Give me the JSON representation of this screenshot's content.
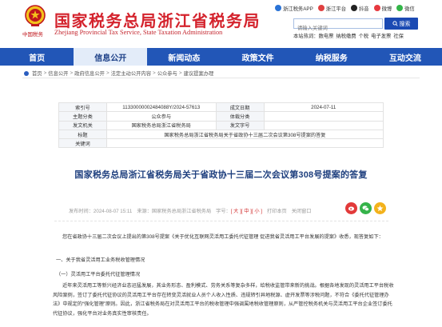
{
  "header": {
    "title": "国家税务总局浙江省税务局",
    "subtitle": "Zhejiang Provincial Tax Service, State Taxation Administration",
    "emblem_text": "中国税务"
  },
  "apps": [
    {
      "label": "浙江税务APP",
      "color": "#2a73d6"
    },
    {
      "label": "浙江平台",
      "color": "#e04040"
    },
    {
      "label": "抖音",
      "color": "#222222"
    },
    {
      "label": "微博",
      "color": "#e7393f"
    },
    {
      "label": "微信",
      "color": "#33b548"
    }
  ],
  "search": {
    "placeholder": "请输入关键词",
    "button_label": "搜索",
    "hot_label": "本站热词：",
    "hot_words": [
      "数电票",
      "纳税缴费",
      "个税",
      "电子发票",
      "社保"
    ]
  },
  "nav": {
    "items": [
      {
        "label": "首页",
        "active": false
      },
      {
        "label": "信息公开",
        "active": true
      },
      {
        "label": "新闻动态",
        "active": false
      },
      {
        "label": "政策文件",
        "active": false
      },
      {
        "label": "纳税服务",
        "active": false
      },
      {
        "label": "互动交流",
        "active": false
      }
    ]
  },
  "breadcrumb": [
    "首页",
    "信息公开",
    "政府信息公开",
    "法定主动公开内容",
    "公众参与",
    "建议提案办理"
  ],
  "info_table": {
    "index_label": "索引号",
    "index_value": "11330000002484088Y/2024-57613",
    "date_label": "成文日期",
    "date_value": "2024-07-11",
    "topic_label": "主题分类",
    "topic_value": "公众参与",
    "genre_label": "体裁分类",
    "genre_value": "",
    "issuer_label": "发文机关",
    "issuer_value": "国家税务总局浙江省税务局",
    "doc_no_label": "发文字号",
    "doc_no_value": "",
    "title_label": "标题",
    "title_value": "国家税务总局浙江省税务局关于省政协十三届二次会议第308号提案的答复",
    "keyword_label": "关键词",
    "keyword_value": ""
  },
  "article": {
    "title": "国家税务总局浙江省税务局关于省政协十三届二次会议第308号提案的答复",
    "publish_time": "发布时间：2024-08-07  15:11",
    "source": "来源：国家税务总局浙江省税务局",
    "font_label": "字号：",
    "size_large": "[ 大 ]",
    "size_medium": "[ 中 ]",
    "size_small": "[ 小 ]",
    "print": "打印本页",
    "close": "关闭窗口",
    "paragraph1": "您在省政协十三届二次会议上提出的第308号提案《关于优化互联网灵活用工委托代征管理 促进我省灵活用工平台发展的提案》收悉，现答复如下：",
    "heading1": "一、关于我省灵活用工业务税收管理情况",
    "heading2": "（一）灵活用工平台委托代征管理情况",
    "paragraph2": "近年来灵活用工等新兴经济业态迅猛发展，其业务形态、盈利模式、劳务关系等复杂多样，给税收监管带来新的挑战。根据各地发现的灵活用工平台税收风险案例，签订了委托代征协议的灵活用工平台存在转变灵活就业人员个人收入性质、违规转引异地税源、虚开发票等涉税问题，不符合《委托代征管理办法》中规定的“强化管理”原则。因此，浙江省税务局在对灵活用工平台的税收管理中强调属地税收管理原则，从严管控税务机关与灵活用工平台企业签订委托代征协议，强化平台对业务真实性审核责任。"
  },
  "share": [
    {
      "icon": "weibo-icon",
      "color": "#e23a3a"
    },
    {
      "icon": "wechat-icon",
      "color": "#35b34a"
    },
    {
      "icon": "qzone-icon",
      "color": "#f3b21b"
    }
  ]
}
